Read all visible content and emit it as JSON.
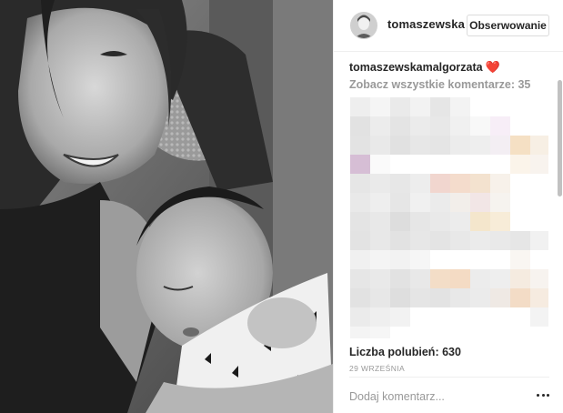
{
  "header": {
    "username": "tomaszewska",
    "follow_label": "Obserwowanie"
  },
  "caption": {
    "author": "tomaszewskamalgorzata",
    "emoji": "❤️"
  },
  "comments": {
    "view_all_label": "Zobacz wszystkie komentarze: 35"
  },
  "stats": {
    "likes_label": "Liczba polubień: 630",
    "date_label": "29 WRZEŚNIA"
  },
  "comment_box": {
    "placeholder": "Dodaj komentarz..."
  },
  "icons": {
    "heart": "heart-icon",
    "more": "more-options-icon"
  },
  "colors": {
    "heart": "#ed2a36",
    "muted_text": "#999999",
    "text": "#262626",
    "divider": "#efefef"
  }
}
